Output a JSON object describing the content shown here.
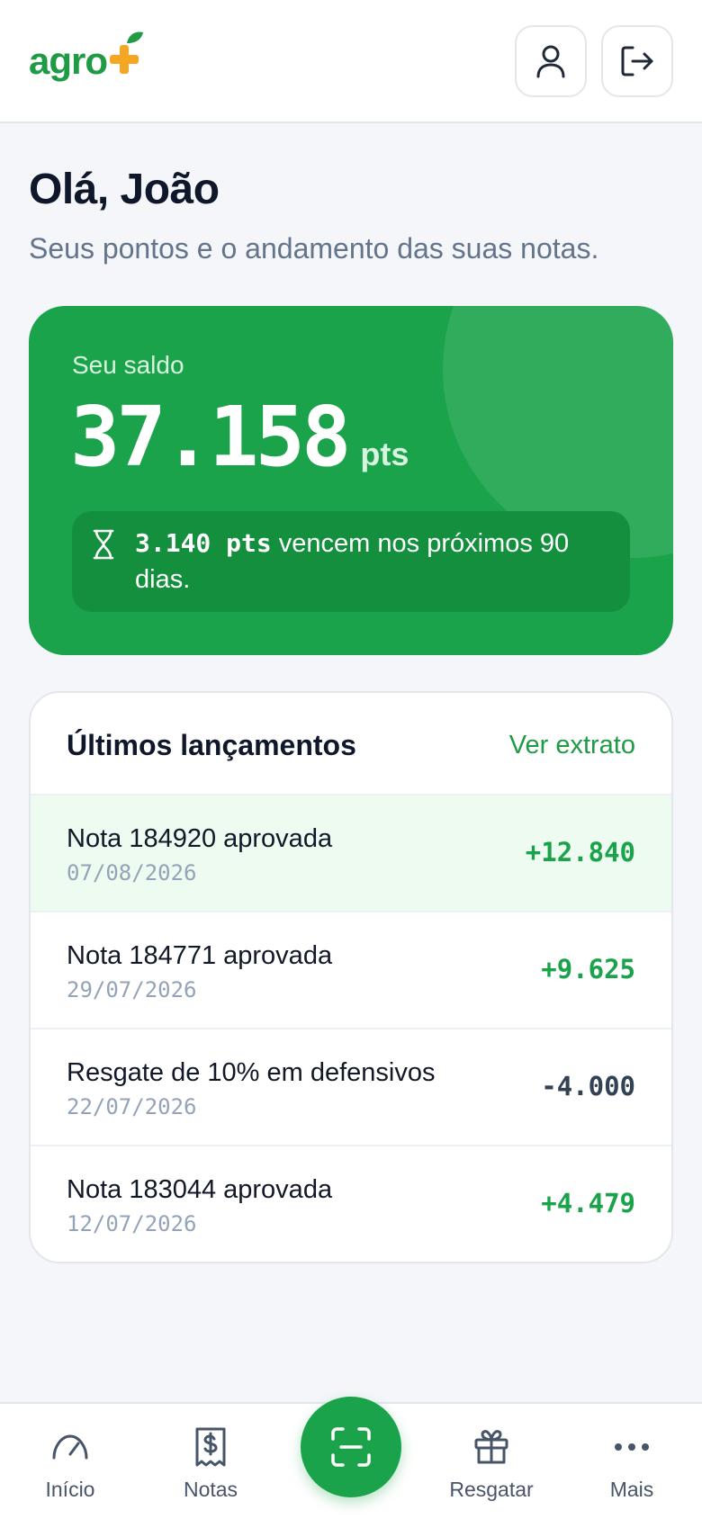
{
  "header": {
    "logo_text": "agro",
    "logo_symbol": "plus-leaf",
    "profile_icon": "user-icon",
    "logout_icon": "logout-icon"
  },
  "greeting": {
    "title": "Olá, João",
    "subtitle": "Seus pontos e o andamento das suas notas."
  },
  "balance": {
    "label": "Seu saldo",
    "value": "37.158",
    "unit": "pts",
    "expiring_pts": "3.140 pts",
    "expiring_text": " vencem nos próximos 90 dias.",
    "expire_icon": "hourglass-icon"
  },
  "transactions": {
    "title": "Últimos lançamentos",
    "link": "Ver extrato",
    "items": [
      {
        "name": "Nota 184920 aprovada",
        "date": "07/08/2026",
        "amount": "+12.840",
        "type": "credit"
      },
      {
        "name": "Nota 184771 aprovada",
        "date": "29/07/2026",
        "amount": "+9.625",
        "type": "credit"
      },
      {
        "name": "Resgate de 10% em defensivos",
        "date": "22/07/2026",
        "amount": "-4.000",
        "type": "debit"
      },
      {
        "name": "Nota 183044 aprovada",
        "date": "12/07/2026",
        "amount": "+4.479",
        "type": "credit"
      }
    ]
  },
  "nav": {
    "items": [
      {
        "label": "Início",
        "icon": "gauge-icon"
      },
      {
        "label": "Notas",
        "icon": "receipt-icon"
      },
      {
        "label": "Resgatar",
        "icon": "gift-icon"
      },
      {
        "label": "Mais",
        "icon": "more-icon"
      }
    ],
    "center_icon": "scan-icon"
  },
  "colors": {
    "brand_green": "#1aa34a",
    "brand_orange": "#f5a623",
    "text_dark": "#0f172a",
    "muted": "#64748b"
  }
}
